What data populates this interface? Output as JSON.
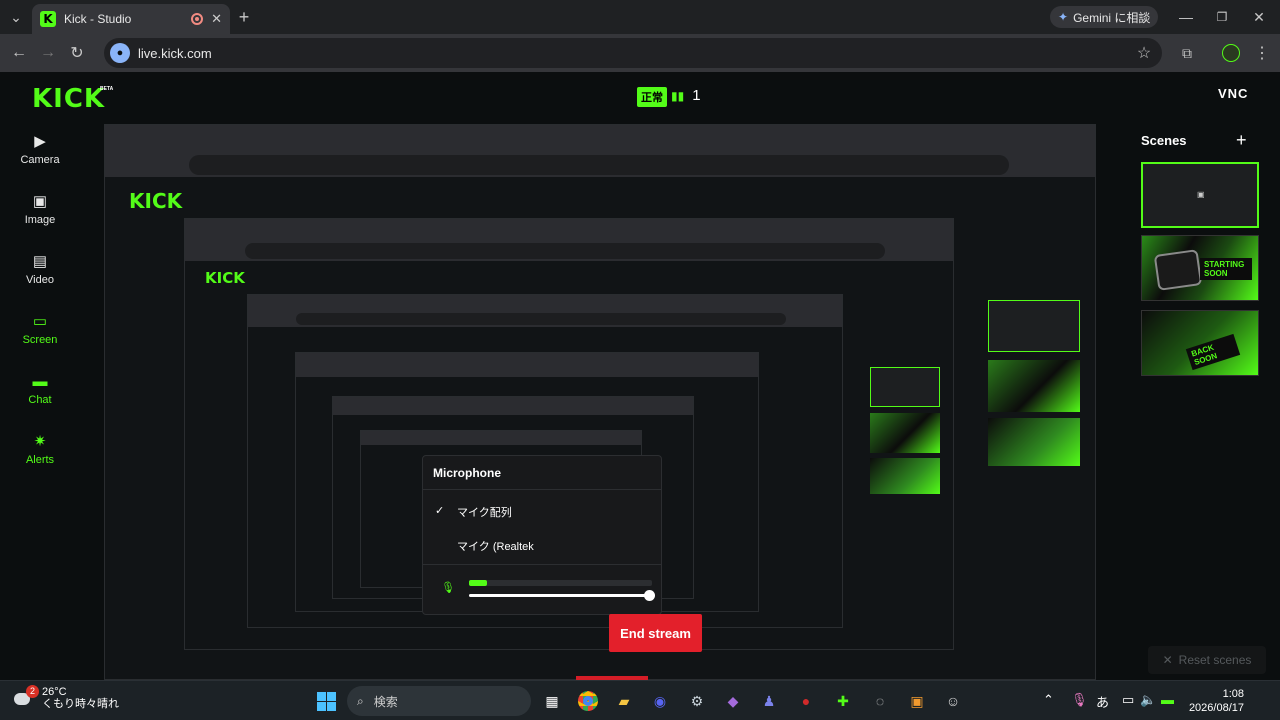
{
  "browser": {
    "tab_title": "Kick - Studio",
    "url": "live.kick.com",
    "gemini_label": "Gemini に相談"
  },
  "header": {
    "logo": "KICK",
    "beta": "BETA",
    "live_status": "正常",
    "viewer_count": "1",
    "avatar_text": "VNC"
  },
  "sidebar": {
    "items": [
      {
        "label": "Camera",
        "icon": "camera-icon",
        "active": false
      },
      {
        "label": "Image",
        "icon": "image-icon",
        "active": false
      },
      {
        "label": "Video",
        "icon": "video-icon",
        "active": false
      },
      {
        "label": "Screen",
        "icon": "screen-icon",
        "active": true
      },
      {
        "label": "Chat",
        "icon": "chat-icon",
        "active": true
      },
      {
        "label": "Alerts",
        "icon": "alerts-icon",
        "active": true
      }
    ]
  },
  "scenes": {
    "title": "Scenes",
    "add": "+",
    "items": [
      {
        "label": "",
        "active": true
      },
      {
        "label": "STARTING SOON",
        "active": false
      },
      {
        "label": "BACK SOON",
        "active": false
      }
    ],
    "reset_label": "Reset scenes"
  },
  "microphone": {
    "title": "Microphone",
    "options": [
      "マイク配列",
      "マイク (Realtek"
    ],
    "selected_index": 0,
    "level": 0.1,
    "volume": 1.0
  },
  "end_stream_label": "End stream",
  "taskbar": {
    "weather_temp": "26°C",
    "weather_desc": "くもり時々晴れ",
    "weather_badge": "2",
    "search_placeholder": "検索",
    "ime": "あ",
    "time": "1:08",
    "date": "2026/08/17"
  },
  "colors": {
    "accent": "#53fc18",
    "danger": "#e3202b",
    "background": "#0b0e0f"
  }
}
